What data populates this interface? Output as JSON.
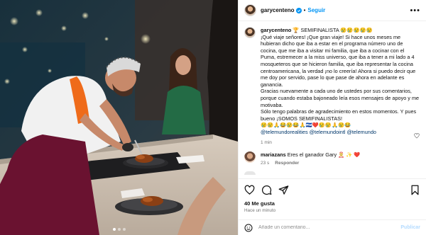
{
  "post": {
    "username": "garycenteno",
    "follow_label": "Seguir",
    "more_label": "•••",
    "caption": {
      "username": "garycenteno",
      "text": " 🏆 SEMIFINALISTA 😢😢😢😢😢\n¡Qué viaje señores! ¡Que gran viaje! Si hace unos meses me hubieran dicho que iba a estar en el programa número uno de cocina, que me iba a visitar mi familia, que iba a cocinar con el Puma, estremecer a la miss universo, que iba a tener a mi lado a 4 mosqueteros que se hicieron familia, que iba representar la cocina centroamericana, la verdad ¡no lo creería! Ahora si puedo decir que me doy por servido, pase lo que pase de ahora en adelante es ganancia.\nGracias nuevamente a cada uno de ustedes por sus comentarios, porque cuando estaba bajoneado leía esos mensajes de apoyo y me motivaba.\nSólo tengo palabras de agradecimiento en estos momentos. Y pues bueno ¡SOMOS SEMIFINALISTAS!\n😢😢🙏😂😢😂🙏🇸🇻❤️😢😢🙏😢😂",
      "tags": "@telemundorealities @telemundointl @telemundo",
      "time": "1 min"
    },
    "comments": [
      {
        "username": "mariazans",
        "text": "Eres el ganador Gary 🤶 ✨ ❤️",
        "time": "23 s",
        "reply_label": "Responder"
      }
    ],
    "likes": "40 Me gusta",
    "posted": "Hace un minuto",
    "comment_placeholder": "Añade un comentario...",
    "publish_label": "Publicar",
    "carousel": {
      "total": 3,
      "active": 1
    }
  },
  "colors": {
    "link": "#0095f6",
    "tag": "#00376b",
    "muted": "#737373",
    "publish_disabled": "#b3dbff"
  },
  "icons": {
    "header": [
      "verified-icon",
      "more-options-icon"
    ],
    "actions": [
      "heart-icon",
      "comment-icon",
      "share-icon",
      "bookmark-icon"
    ],
    "input": [
      "emoji-icon"
    ]
  }
}
